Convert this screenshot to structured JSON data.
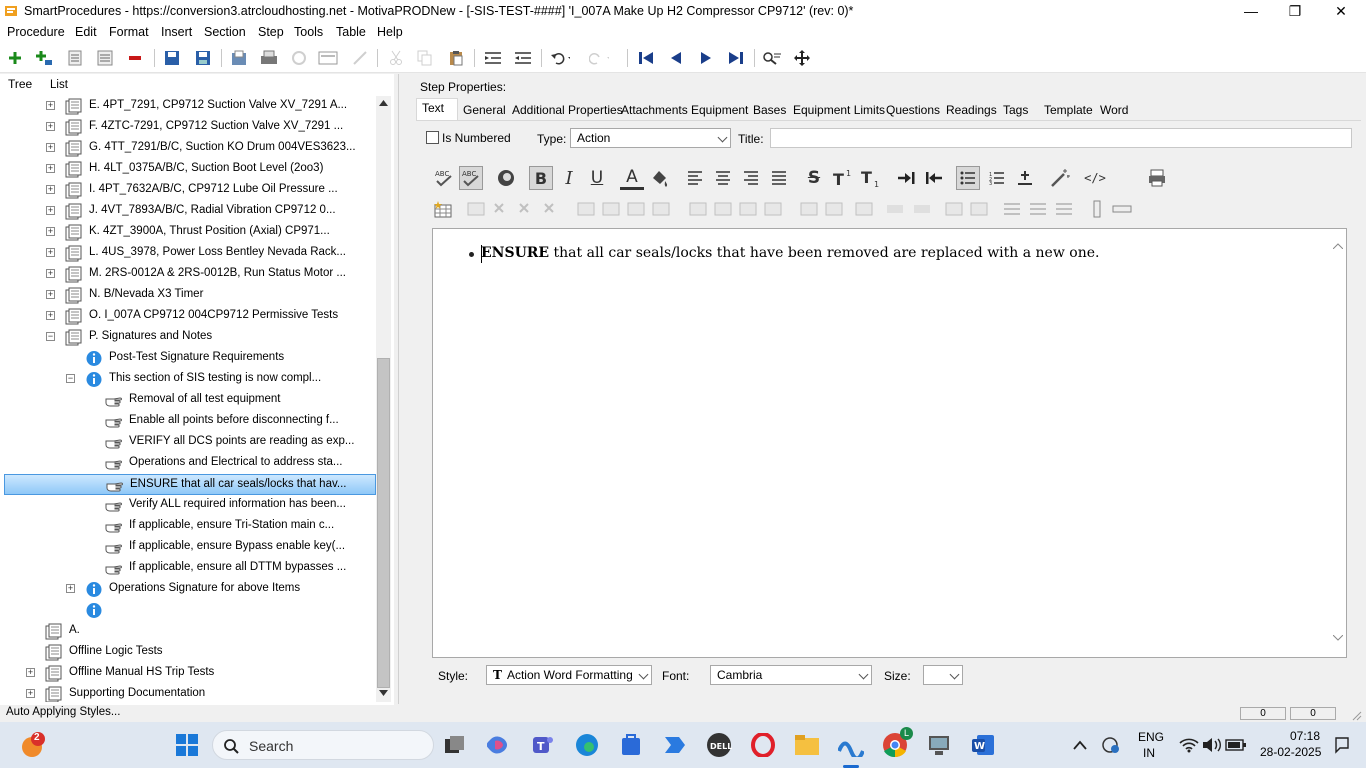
{
  "window": {
    "title": "SmartProcedures - https://conversion3.atrcloudhosting.net - MotivaPRODNew - [-SIS-TEST-####] 'I_007A Make Up H2 Compressor CP9712' (rev: 0)*",
    "minimize": "—",
    "maximize": "❐",
    "close": "✕"
  },
  "menu": {
    "items": [
      "Procedure",
      "Edit",
      "Format",
      "Insert",
      "Section",
      "Step",
      "Tools",
      "Table",
      "Help"
    ]
  },
  "toolbar": {
    "icons": [
      "add-icon",
      "add-child-icon",
      "collapse-icon",
      "expand-icon",
      "remove-icon",
      "save-all-icon",
      "save-icon",
      "export-icon",
      "print-icon",
      "refresh-icon",
      "preview-icon",
      "wizard-icon",
      "cut-icon",
      "copy-icon",
      "paste-icon",
      "indent-icon",
      "outdent-icon",
      "undo-icon",
      "redo-icon",
      "first-icon",
      "previous-icon",
      "next-icon",
      "last-icon",
      "find-icon",
      "move-icon"
    ]
  },
  "left_panel": {
    "tabs": [
      "Tree",
      "List"
    ],
    "tree": [
      {
        "label": "E. 4PT_7291, CP9712 Suction Valve XV_7291 A...",
        "type": "section",
        "expander": "+",
        "level": 2
      },
      {
        "label": "F. 4ZTC-7291, CP9712 Suction Valve XV_7291 ...",
        "type": "section",
        "expander": "+",
        "level": 2
      },
      {
        "label": "G. 4TT_7291/B/C, Suction KO Drum 004VES3623...",
        "type": "section",
        "expander": "+",
        "level": 2
      },
      {
        "label": "H. 4LT_0375A/B/C, Suction Boot Level (2oo3)",
        "type": "section",
        "expander": "+",
        "level": 2
      },
      {
        "label": "I. 4PT_7632A/B/C, CP9712 Lube Oil Pressure ...",
        "type": "section",
        "expander": "+",
        "level": 2
      },
      {
        "label": "J. 4VT_7893A/B/C, Radial Vibration CP9712 0...",
        "type": "section",
        "expander": "+",
        "level": 2
      },
      {
        "label": "K. 4ZT_3900A, Thrust Position (Axial) CP971...",
        "type": "section",
        "expander": "+",
        "level": 2
      },
      {
        "label": "L. 4US_3978, Power Loss Bentley Nevada Rack...",
        "type": "section",
        "expander": "+",
        "level": 2
      },
      {
        "label": "M. 2RS-0012A & 2RS-0012B, Run Status Motor ...",
        "type": "section",
        "expander": "+",
        "level": 2
      },
      {
        "label": "N. B/Nevada X3 Timer",
        "type": "section",
        "expander": "+",
        "level": 2
      },
      {
        "label": "O. I_007A CP9712 004CP9712 Permissive Tests",
        "type": "section",
        "expander": "+",
        "level": 2
      },
      {
        "label": "P. Signatures and Notes",
        "type": "section",
        "expander": "−",
        "level": 2
      },
      {
        "label": "Post-Test Signature Requirements",
        "type": "info",
        "expander": "",
        "level": 3
      },
      {
        "label": "This section of SIS testing is now compl...",
        "type": "info",
        "expander": "−",
        "level": 3
      },
      {
        "label": "Removal of all test equipment",
        "type": "step",
        "expander": "",
        "level": 4
      },
      {
        "label": "Enable all points before disconnecting f...",
        "type": "step",
        "expander": "",
        "level": 4
      },
      {
        "label": "VERIFY all DCS points are reading as exp...",
        "type": "step",
        "expander": "",
        "level": 4
      },
      {
        "label": "Operations and Electrical to address sta...",
        "type": "step",
        "expander": "",
        "level": 4
      },
      {
        "label": "ENSURE that all car seals/locks that hav...",
        "type": "step",
        "expander": "",
        "level": 4,
        "selected": true
      },
      {
        "label": "Verify ALL required information has been...",
        "type": "step",
        "expander": "",
        "level": 4
      },
      {
        "label": "If applicable, ensure Tri-Station main c...",
        "type": "step",
        "expander": "",
        "level": 4
      },
      {
        "label": "If applicable, ensure Bypass enable key(...",
        "type": "step",
        "expander": "",
        "level": 4
      },
      {
        "label": "If applicable, ensure all DTTM bypasses ...",
        "type": "step",
        "expander": "",
        "level": 4
      },
      {
        "label": "Operations Signature for above Items",
        "type": "info",
        "expander": "+",
        "level": 3
      },
      {
        "label": "",
        "type": "info",
        "expander": "",
        "level": 3
      },
      {
        "label": "A.",
        "type": "section",
        "expander": "",
        "level": 1
      },
      {
        "label": "Offline Logic Tests",
        "type": "section",
        "expander": "",
        "level": 1
      },
      {
        "label": "Offline Manual HS Trip Tests",
        "type": "section",
        "expander": "+",
        "level": 1
      },
      {
        "label": "Supporting Documentation",
        "type": "section",
        "expander": "+",
        "level": 1
      }
    ]
  },
  "right_panel": {
    "heading": "Step Properties:",
    "tabs": [
      "Text",
      "General",
      "Additional Properties",
      "Attachments",
      "Equipment",
      "Bases",
      "Equipment Limits",
      "Questions",
      "Readings",
      "Tags",
      "Template",
      "Word"
    ],
    "is_numbered_label": "Is Numbered",
    "is_numbered_checked": false,
    "type_label": "Type:",
    "type_value": "Action",
    "title_label": "Title:",
    "title_value": "",
    "editor_bold": "ENSURE",
    "editor_rest": " that all car seals/locks that have been removed are replaced with a new one.",
    "style_label": "Style:",
    "style_value": "Action Word Formatting",
    "style_glyph": "T",
    "font_label": "Font:",
    "font_value": "Cambria",
    "size_label": "Size:",
    "size_value": ""
  },
  "format_toolbar": {
    "icons": [
      "spell-check-icon",
      "spell-check-as-you-type-icon",
      "ink-icon",
      "bold-icon",
      "italic-icon",
      "underline-icon",
      "font-color-icon",
      "highlight-icon",
      "align-left-icon",
      "align-center-icon",
      "align-right-icon",
      "justify-icon",
      "strikethrough-icon",
      "superscript-icon",
      "subscript-icon",
      "indent-increase-icon",
      "indent-decrease-icon",
      "bullet-list-icon",
      "numbered-list-icon",
      "insert-line-icon",
      "magic-wand-icon",
      "html-code-icon",
      "print-preview-icon"
    ],
    "bold_active": true,
    "bullets_active": true,
    "bold_glyph": "B",
    "italic_glyph": "I",
    "underline_glyph": "U",
    "font_color_glyph": "A",
    "strike_glyph": "S",
    "html_glyph": "</>"
  },
  "status_bar": {
    "text": "Auto Applying Styles...",
    "field1": "0",
    "field2": "0"
  },
  "taskbar": {
    "search_placeholder": "Search",
    "notification_badge": "2",
    "language": "ENG",
    "region": "IN",
    "time": "07:18",
    "date": "28-02-2025",
    "chrome_badge": "L"
  }
}
